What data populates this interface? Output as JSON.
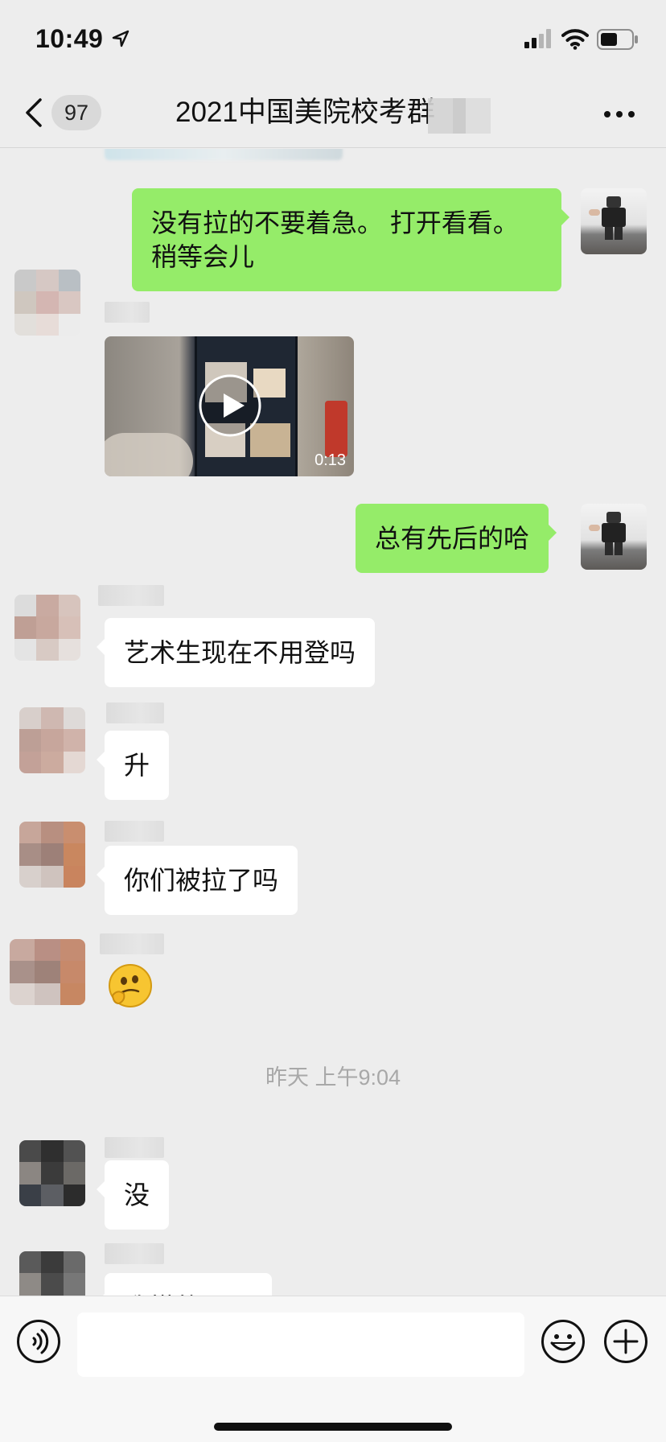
{
  "status_bar": {
    "time": "10:49",
    "icons": [
      "location-arrow-icon",
      "cellular-signal-icon",
      "wifi-icon",
      "battery-icon"
    ]
  },
  "nav": {
    "unread_count": "97",
    "title": "2021中国美院校考群",
    "icons": [
      "chevron-left-icon",
      "more-dots-icon"
    ]
  },
  "messages": [
    {
      "side": "out",
      "type": "text",
      "text": "没有拉的不要着急。 打开看看。\n稍等会儿"
    },
    {
      "side": "in",
      "type": "video",
      "duration": "0:13"
    },
    {
      "side": "out",
      "type": "text",
      "text": "总有先后的哈"
    },
    {
      "side": "in",
      "type": "text",
      "text": "艺术生现在不用登吗"
    },
    {
      "side": "in",
      "type": "text",
      "text": "升"
    },
    {
      "side": "in",
      "type": "text",
      "text": "你们被拉了吗"
    },
    {
      "side": "in",
      "type": "sticker",
      "sticker": "thinking-face-sticker"
    },
    {
      "type": "timestamp",
      "text": "昨天 上午9:04"
    },
    {
      "side": "in",
      "type": "text",
      "text": "没"
    },
    {
      "side": "in",
      "type": "text",
      "text": "我搭的下了"
    }
  ],
  "input_bar": {
    "placeholder": "",
    "icons": [
      "voice-icon",
      "emoji-icon",
      "plus-icon"
    ]
  },
  "colors": {
    "background": "#ededed",
    "outgoing_bubble": "#95ec69",
    "incoming_bubble": "#ffffff",
    "timestamp_text": "#a8a8a8"
  }
}
